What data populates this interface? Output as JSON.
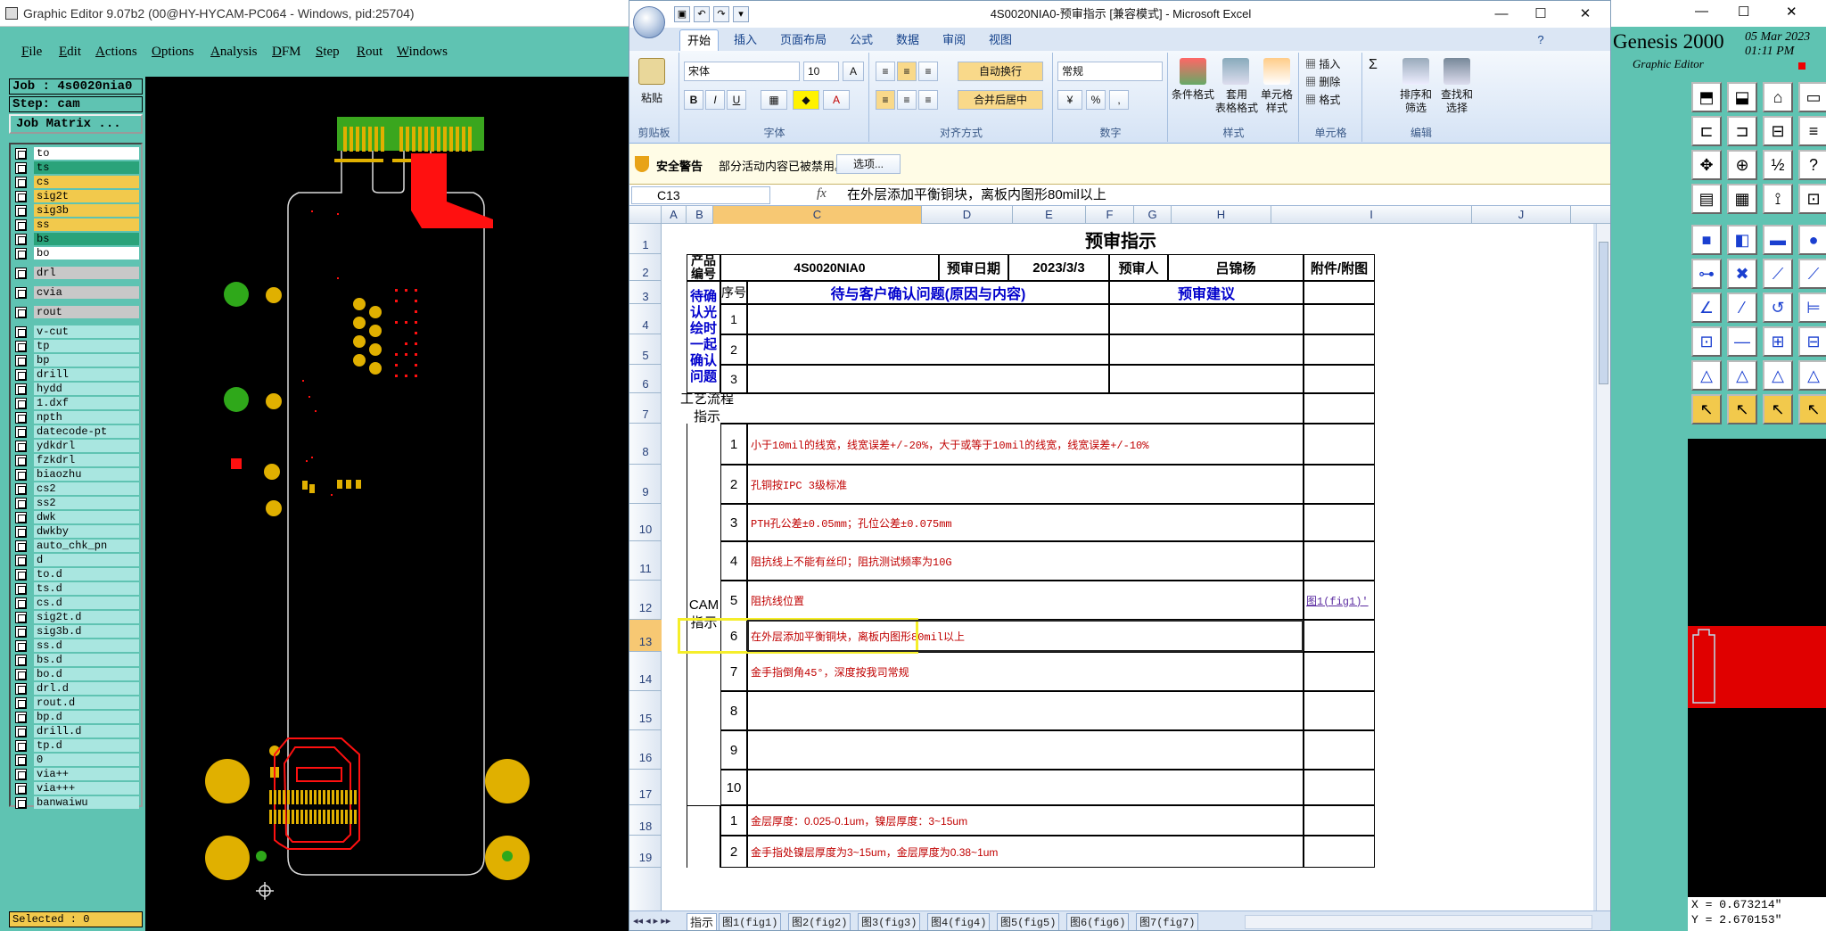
{
  "genesis_left": {
    "title": "Graphic Editor 9.07b2 (00@HY-HYCAM-PC064 - Windows, pid:25704)",
    "menu": [
      "File",
      "Edit",
      "Actions",
      "Options",
      "Analysis",
      "DFM",
      "Step",
      "Rout",
      "Windows"
    ],
    "job": "Job : 4s0020nia0",
    "step": "Step: cam",
    "job_matrix": "Job Matrix ...",
    "layers": [
      {
        "name": "to",
        "color": "#ffffff"
      },
      {
        "name": "ts",
        "color": "#2aa37a"
      },
      {
        "name": "cs",
        "color": "#f2c94c"
      },
      {
        "name": "sig2t",
        "color": "#f2c94c"
      },
      {
        "name": "sig3b",
        "color": "#f2c94c"
      },
      {
        "name": "ss",
        "color": "#f2c94c"
      },
      {
        "name": "bs",
        "color": "#2aa37a"
      },
      {
        "name": "bo",
        "color": "#ffffff"
      },
      {
        "name": "drl",
        "color": "#c8c8c8"
      },
      {
        "name": "cvia",
        "color": "#c8c8c8"
      },
      {
        "name": "rout",
        "color": "#c8c8c8"
      },
      {
        "name": "v-cut",
        "color": "#a9e6e0"
      },
      {
        "name": "tp",
        "color": "#a9e6e0"
      },
      {
        "name": "bp",
        "color": "#a9e6e0"
      },
      {
        "name": "drill",
        "color": "#a9e6e0"
      },
      {
        "name": "hydd",
        "color": "#a9e6e0"
      },
      {
        "name": "1.dxf",
        "color": "#a9e6e0"
      },
      {
        "name": "npth",
        "color": "#a9e6e0"
      },
      {
        "name": "datecode-pt",
        "color": "#a9e6e0"
      },
      {
        "name": "ydkdrl",
        "color": "#a9e6e0"
      },
      {
        "name": "fzkdrl",
        "color": "#a9e6e0"
      },
      {
        "name": "biaozhu",
        "color": "#a9e6e0"
      },
      {
        "name": "cs2",
        "color": "#a9e6e0"
      },
      {
        "name": "ss2",
        "color": "#a9e6e0"
      },
      {
        "name": "dwk",
        "color": "#a9e6e0"
      },
      {
        "name": "dwkby",
        "color": "#a9e6e0"
      },
      {
        "name": "auto_chk_pn",
        "color": "#a9e6e0"
      },
      {
        "name": "d",
        "color": "#a9e6e0"
      },
      {
        "name": "to.d",
        "color": "#a9e6e0"
      },
      {
        "name": "ts.d",
        "color": "#a9e6e0"
      },
      {
        "name": "cs.d",
        "color": "#a9e6e0"
      },
      {
        "name": "sig2t.d",
        "color": "#a9e6e0"
      },
      {
        "name": "sig3b.d",
        "color": "#a9e6e0"
      },
      {
        "name": "ss.d",
        "color": "#a9e6e0"
      },
      {
        "name": "bs.d",
        "color": "#a9e6e0"
      },
      {
        "name": "bo.d",
        "color": "#a9e6e0"
      },
      {
        "name": "drl.d",
        "color": "#a9e6e0"
      },
      {
        "name": "rout.d",
        "color": "#a9e6e0"
      },
      {
        "name": "bp.d",
        "color": "#a9e6e0"
      },
      {
        "name": "drill.d",
        "color": "#a9e6e0"
      },
      {
        "name": "tp.d",
        "color": "#a9e6e0"
      },
      {
        "name": "0",
        "color": "#a9e6e0"
      },
      {
        "name": "via++",
        "color": "#a9e6e0"
      },
      {
        "name": "via+++",
        "color": "#a9e6e0"
      },
      {
        "name": "banwaiwu",
        "color": "#a9e6e0"
      }
    ],
    "selected": "Selected : 0"
  },
  "excel": {
    "title": "4S0020NIA0-预审指示  [兼容模式] - Microsoft Excel",
    "tabs": [
      "开始",
      "插入",
      "页面布局",
      "公式",
      "数据",
      "审阅",
      "视图"
    ],
    "ribbon": {
      "paste": "粘贴",
      "font_name": "宋体",
      "font_size": "10",
      "wrap": "自动换行",
      "merge": "合并后居中",
      "number_format": "常规",
      "cond_format": "条件格式",
      "table_format": "套用\n表格格式",
      "cell_style": "单元格\n样式",
      "insert": "插入",
      "delete": "删除",
      "format": "格式",
      "sort": "排序和\n筛选",
      "find": "查找和\n选择",
      "groups": [
        "剪贴板",
        "字体",
        "对齐方式",
        "数字",
        "样式",
        "单元格",
        "编辑"
      ]
    },
    "security_warning": "安全警告",
    "security_text": "部分活动内容已被禁用。",
    "options_btn": "选项...",
    "name_box": "C13",
    "fx": "fx",
    "formula": "在外层添加平衡铜块，离板内图形80mil以上",
    "columns": [
      "A",
      "B",
      "C",
      "D",
      "E",
      "F",
      "G",
      "H",
      "I",
      "J"
    ],
    "rows": [
      "1",
      "2",
      "3",
      "4",
      "5",
      "6",
      "7",
      "8",
      "9",
      "10",
      "11",
      "12",
      "13",
      "14",
      "15",
      "16",
      "17",
      "18",
      "19"
    ],
    "sheet": {
      "title": "预审指示",
      "product_no_label": "产品编号",
      "product_no": "4S0020NIA0",
      "date_label": "预审日期",
      "date": "2023/3/3",
      "reviewer_label": "预审人",
      "reviewer": "吕锦杨",
      "attach_label": "附件/附图",
      "seq_label": "序号",
      "confirm_header": "待与客户确认问题(原因与内容)",
      "suggest_header": "预审建议",
      "confirm_section": "待确认光绘时一起确认问题",
      "process_label": "工艺流程指示",
      "cam_label": "CAM指示",
      "confirm_seq": [
        "1",
        "2",
        "3"
      ],
      "cam_items": [
        {
          "n": "1",
          "text": "小于10mil的线宽，线宽误差+/-20%，大于或等于10mil的线宽，线宽误差+/-10%",
          "attach": ""
        },
        {
          "n": "2",
          "text": "孔铜按IPC 3级标准",
          "attach": ""
        },
        {
          "n": "3",
          "text": "PTH孔公差±0.05mm；孔位公差±0.075mm",
          "attach": ""
        },
        {
          "n": "4",
          "text": "阻抗线上不能有丝印；阻抗测试频率为10G",
          "attach": ""
        },
        {
          "n": "5",
          "text": "阻抗线位置",
          "attach": "图1(fig1)'"
        },
        {
          "n": "6",
          "text": "在外层添加平衡铜块，离板内图形80mil以上",
          "attach": ""
        },
        {
          "n": "7",
          "text": "金手指倒角45°，深度按我司常规",
          "attach": ""
        },
        {
          "n": "8",
          "text": "",
          "attach": ""
        },
        {
          "n": "9",
          "text": "",
          "attach": ""
        },
        {
          "n": "10",
          "text": "",
          "attach": ""
        }
      ],
      "bottom_items": [
        {
          "n": "1",
          "text": "金层厚度：0.025-0.1um，镍层厚度：3~15um"
        },
        {
          "n": "2",
          "text": "金手指处镍层厚度为3~15um，金层厚度为0.38~1um"
        }
      ]
    },
    "sheet_tabs": [
      "指示",
      "图1(fig1)",
      "图2(fig2)",
      "图3(fig3)",
      "图4(fig4)",
      "图5(fig5)",
      "图6(fig6)",
      "图7(fig7)"
    ]
  },
  "genesis_right": {
    "brand": "Genesis 2000",
    "subtitle": "Graphic Editor",
    "date": "05 Mar 2023",
    "time": "01:11 PM",
    "x": "X = 0.673214\"",
    "y": "Y = 2.670153\""
  }
}
